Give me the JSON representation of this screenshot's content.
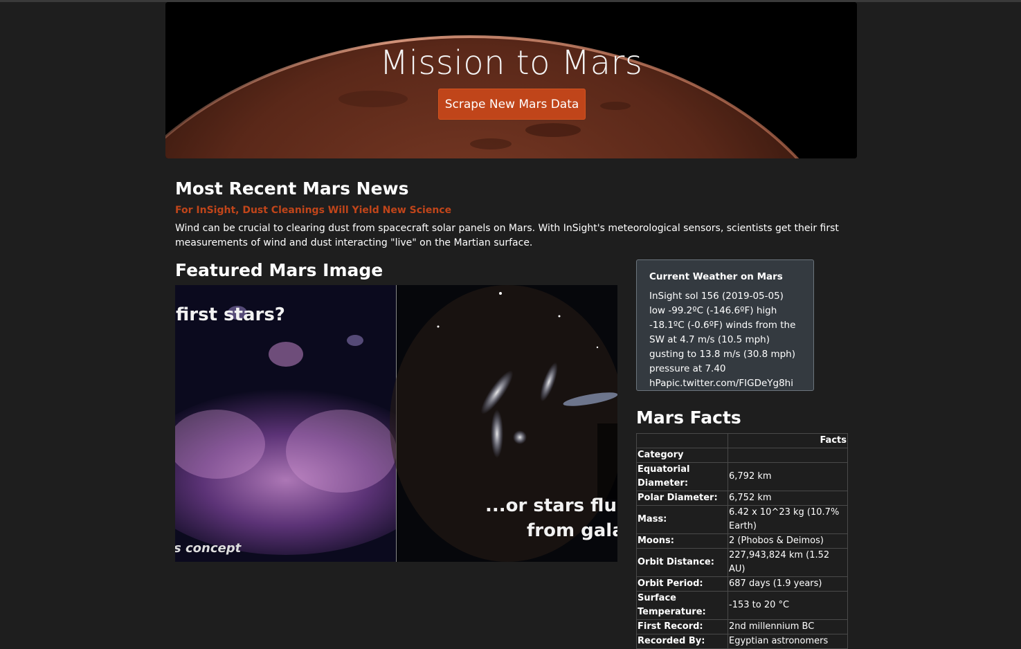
{
  "hero": {
    "title": "Mission to Mars",
    "button_label": "Scrape New Mars Data"
  },
  "news": {
    "heading": "Most Recent Mars News",
    "title": "For InSight, Dust Cleanings Will Yield New Science",
    "body": "Wind can be crucial to clearing dust from spacecraft solar panels on Mars. With InSight's meteorological sensors, scientists get their first measurements of wind and dust interacting \"live\" on the Martian surface."
  },
  "featured": {
    "heading": "Featured Mars Image",
    "caption_left_top": "first stars?",
    "caption_left_bottom": "s concept",
    "caption_right_1": "...or stars flung",
    "caption_right_2": "from galax"
  },
  "weather": {
    "title": "Current Weather on Mars",
    "body": "InSight sol 156 (2019-05-05) low -99.2ºC (-146.6ºF) high -18.1ºC (-0.6ºF) winds from the SW at 4.7 m/s (10.5 mph) gusting to 13.8 m/s (30.8 mph) pressure at 7.40 hPapic.twitter.com/FIGDeYg8hi"
  },
  "facts": {
    "heading": "Mars Facts",
    "column_header": "Facts",
    "index_header": "Category",
    "rows": [
      {
        "k": "Equatorial Diameter:",
        "v": "6,792 km"
      },
      {
        "k": "Polar Diameter:",
        "v": "6,752 km"
      },
      {
        "k": "Mass:",
        "v": "6.42 x 10^23 kg (10.7% Earth)"
      },
      {
        "k": "Moons:",
        "v": "2 (Phobos & Deimos)"
      },
      {
        "k": "Orbit Distance:",
        "v": "227,943,824 km (1.52 AU)"
      },
      {
        "k": "Orbit Period:",
        "v": "687 days (1.9 years)"
      },
      {
        "k": "Surface Temperature:",
        "v": "-153 to 20 °C"
      },
      {
        "k": "First Record:",
        "v": "2nd millennium BC"
      },
      {
        "k": "Recorded By:",
        "v": "Egyptian astronomers"
      }
    ]
  },
  "colors": {
    "background": "#1e1e1e",
    "accent": "#c0451a",
    "weather_panel": "#343a40"
  }
}
